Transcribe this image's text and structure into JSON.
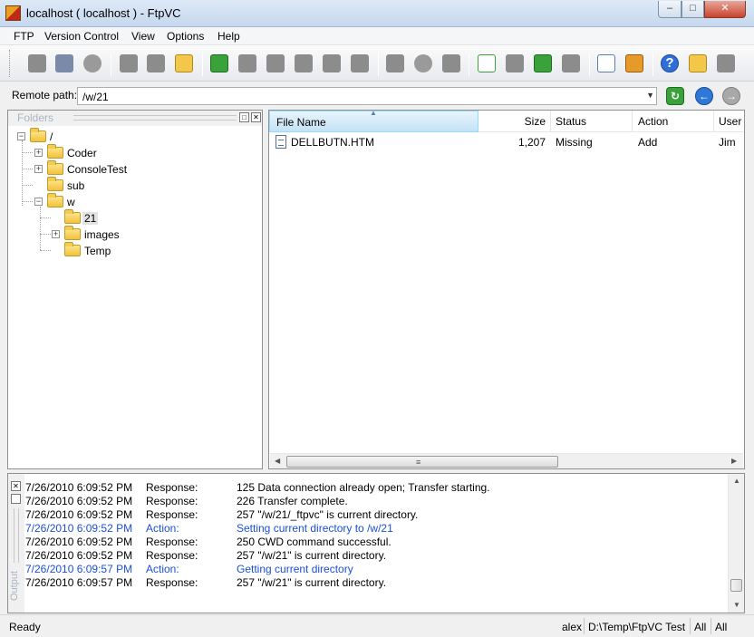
{
  "window": {
    "title": "localhost  ( localhost ) - FtpVC"
  },
  "menu": [
    "FTP",
    "Version Control",
    "View",
    "Options",
    "Help"
  ],
  "toolbar": {
    "icons": [
      "connect-icon",
      "disconnect-icon",
      "stop-icon",
      "upload-icon",
      "download-icon",
      "new-folder-icon",
      "add-file-icon",
      "checkout-icon",
      "checkin-icon",
      "undo-checkout-icon",
      "get-latest-icon",
      "history-icon",
      "compare-icon",
      "label-icon",
      "share-icon",
      "branch-icon",
      "refresh-status-icon",
      "delete-icon",
      "sync-icon",
      "merge-icon",
      "options-icon",
      "configure-icon",
      "help-icon",
      "open-folder-icon",
      "export-icon"
    ]
  },
  "remote_path": {
    "label": "Remote path:",
    "value": "/w/21"
  },
  "folders": {
    "title": "Folders",
    "tree": [
      {
        "label": "/",
        "depth": 0,
        "expander": "−"
      },
      {
        "label": "Coder",
        "depth": 1,
        "expander": "+"
      },
      {
        "label": "ConsoleTest",
        "depth": 1,
        "expander": "+"
      },
      {
        "label": "sub",
        "depth": 1,
        "expander": ""
      },
      {
        "label": "w",
        "depth": 1,
        "expander": "−"
      },
      {
        "label": "21",
        "depth": 2,
        "expander": "",
        "selected": true
      },
      {
        "label": "images",
        "depth": 2,
        "expander": "+"
      },
      {
        "label": "Temp",
        "depth": 2,
        "expander": ""
      }
    ]
  },
  "files": {
    "columns": [
      "File Name",
      "Size",
      "Status",
      "Action",
      "User"
    ],
    "rows": [
      {
        "name": "DELLBUTN.HTM",
        "size": "1,207",
        "status": "Missing",
        "action": "Add",
        "user": "Jim"
      }
    ]
  },
  "output": {
    "title": "Output",
    "log": [
      {
        "time": "7/26/2010 6:09:52 PM",
        "type": "Response:",
        "message": "125 Data connection already open; Transfer starting.",
        "kind": "response"
      },
      {
        "time": "7/26/2010 6:09:52 PM",
        "type": "Response:",
        "message": "226 Transfer complete.",
        "kind": "response"
      },
      {
        "time": "7/26/2010 6:09:52 PM",
        "type": "Response:",
        "message": "257 \"/w/21/_ftpvc\" is current directory.",
        "kind": "response"
      },
      {
        "time": "7/26/2010 6:09:52 PM",
        "type": "Action:",
        "message": "Setting current directory to /w/21",
        "kind": "action"
      },
      {
        "time": "7/26/2010 6:09:52 PM",
        "type": "Response:",
        "message": "250 CWD command successful.",
        "kind": "response"
      },
      {
        "time": "7/26/2010 6:09:52 PM",
        "type": "Response:",
        "message": "257 \"/w/21\" is current directory.",
        "kind": "response"
      },
      {
        "time": "7/26/2010 6:09:57 PM",
        "type": "Action:",
        "message": "Getting current directory",
        "kind": "action"
      },
      {
        "time": "7/26/2010 6:09:57 PM",
        "type": "Response:",
        "message": "257 \"/w/21\" is current directory.",
        "kind": "response"
      }
    ]
  },
  "status": {
    "text": "Ready",
    "user": "alex",
    "project": "D:\\Temp\\FtpVC Test",
    "filter1": "All",
    "filter2": "All"
  }
}
